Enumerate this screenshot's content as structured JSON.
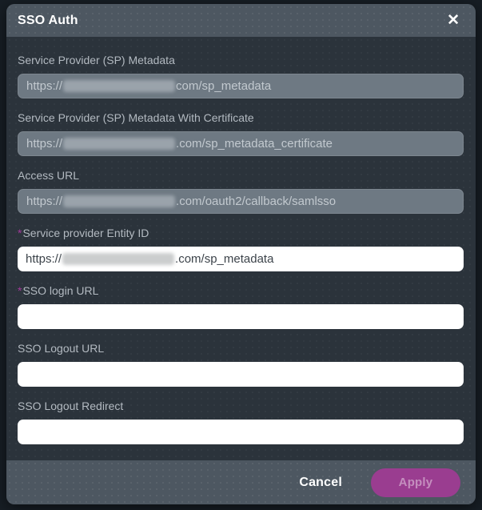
{
  "modal": {
    "title": "SSO Auth",
    "close_icon": "✕"
  },
  "required_marker": "*",
  "fields": [
    {
      "label": "Service Provider (SP) Metadata",
      "required": false,
      "readonly": true,
      "value_prefix": "https://",
      "value_redacted": true,
      "value_suffix": "com/sp_metadata"
    },
    {
      "label": "Service Provider (SP) Metadata With Certificate",
      "required": false,
      "readonly": true,
      "value_prefix": "https://",
      "value_redacted": true,
      "value_suffix": ".com/sp_metadata_certificate"
    },
    {
      "label": "Access URL",
      "required": false,
      "readonly": true,
      "value_prefix": "https://",
      "value_redacted": true,
      "value_suffix": ".com/oauth2/callback/samlsso"
    },
    {
      "label": "Service provider Entity ID",
      "required": true,
      "readonly": false,
      "value_prefix": "https://",
      "value_redacted": true,
      "value_suffix": ".com/sp_metadata"
    },
    {
      "label": "SSO login URL",
      "required": true,
      "readonly": false,
      "value": ""
    },
    {
      "label": "SSO Logout URL",
      "required": false,
      "readonly": false,
      "value": ""
    },
    {
      "label": "SSO Logout Redirect",
      "required": false,
      "readonly": false,
      "value": ""
    }
  ],
  "footer": {
    "cancel_label": "Cancel",
    "apply_label": "Apply",
    "apply_disabled": true
  },
  "colors": {
    "overlay_background": "#171e25",
    "modal_body": "#2b333b",
    "header_footer": "#4d5761",
    "label_text": "#b3bac1",
    "readonly_input": "#6e7983",
    "editable_input": "#ffffff",
    "required_asterisk": "#a23a9b",
    "apply_button": "#9a3d90"
  }
}
